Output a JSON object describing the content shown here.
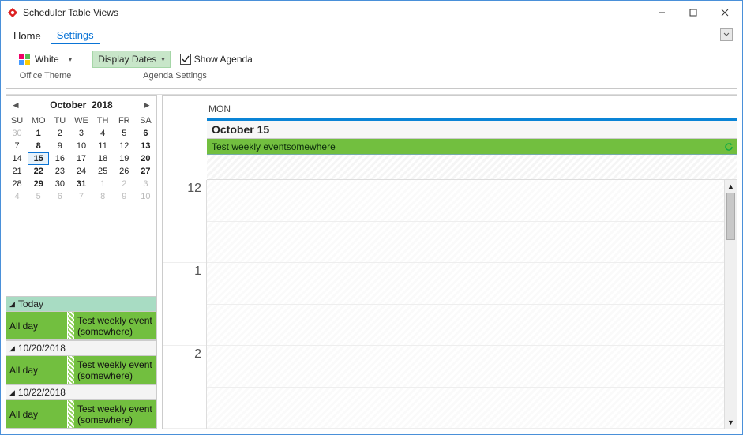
{
  "window": {
    "title": "Scheduler Table Views"
  },
  "menu": {
    "items": [
      "Home",
      "Settings"
    ],
    "active": 1
  },
  "ribbon": {
    "theme_name": "White",
    "theme_group_label": "Office Theme",
    "display_dates": "Display Dates",
    "show_agenda": "Show Agenda",
    "agenda_group_label": "Agenda Settings"
  },
  "datenav": {
    "month": "October",
    "year": "2018",
    "dow": [
      "SU",
      "MO",
      "TU",
      "WE",
      "TH",
      "FR",
      "SA"
    ],
    "weeks": [
      [
        {
          "n": "30",
          "dim": true
        },
        {
          "n": "1",
          "bold": true
        },
        {
          "n": "2"
        },
        {
          "n": "3"
        },
        {
          "n": "4"
        },
        {
          "n": "5"
        },
        {
          "n": "6",
          "bold": true
        }
      ],
      [
        {
          "n": "7"
        },
        {
          "n": "8",
          "bold": true
        },
        {
          "n": "9"
        },
        {
          "n": "10"
        },
        {
          "n": "11"
        },
        {
          "n": "12"
        },
        {
          "n": "13",
          "bold": true
        }
      ],
      [
        {
          "n": "14"
        },
        {
          "n": "15",
          "bold": true,
          "sel": true
        },
        {
          "n": "16"
        },
        {
          "n": "17"
        },
        {
          "n": "18"
        },
        {
          "n": "19"
        },
        {
          "n": "20",
          "bold": true
        }
      ],
      [
        {
          "n": "21"
        },
        {
          "n": "22",
          "bold": true
        },
        {
          "n": "23"
        },
        {
          "n": "24"
        },
        {
          "n": "25"
        },
        {
          "n": "26"
        },
        {
          "n": "27",
          "bold": true
        }
      ],
      [
        {
          "n": "28"
        },
        {
          "n": "29",
          "bold": true
        },
        {
          "n": "30"
        },
        {
          "n": "31",
          "bold": true
        },
        {
          "n": "1",
          "dim": true
        },
        {
          "n": "2",
          "dim": true
        },
        {
          "n": "3",
          "dim": true
        }
      ],
      [
        {
          "n": "4",
          "dim": true
        },
        {
          "n": "5",
          "dim": true
        },
        {
          "n": "6",
          "dim": true
        },
        {
          "n": "7",
          "dim": true
        },
        {
          "n": "8",
          "dim": true
        },
        {
          "n": "9",
          "dim": true
        },
        {
          "n": "10",
          "dim": true
        }
      ]
    ]
  },
  "agenda": {
    "groups": [
      {
        "header": "Today",
        "today": true,
        "time": "All day",
        "event_title": "Test weekly event",
        "event_loc": "(somewhere)"
      },
      {
        "header": "10/20/2018",
        "time": "All day",
        "event_title": "Test weekly event",
        "event_loc": "(somewhere)"
      },
      {
        "header": "10/22/2018",
        "time": "All day",
        "event_title": "Test weekly event",
        "event_loc": "(somewhere)"
      }
    ]
  },
  "dayview": {
    "dow": "MON",
    "date": "October 15",
    "allday_event": "Test weekly eventsomewhere",
    "hours": [
      "12",
      "1",
      "2"
    ]
  }
}
